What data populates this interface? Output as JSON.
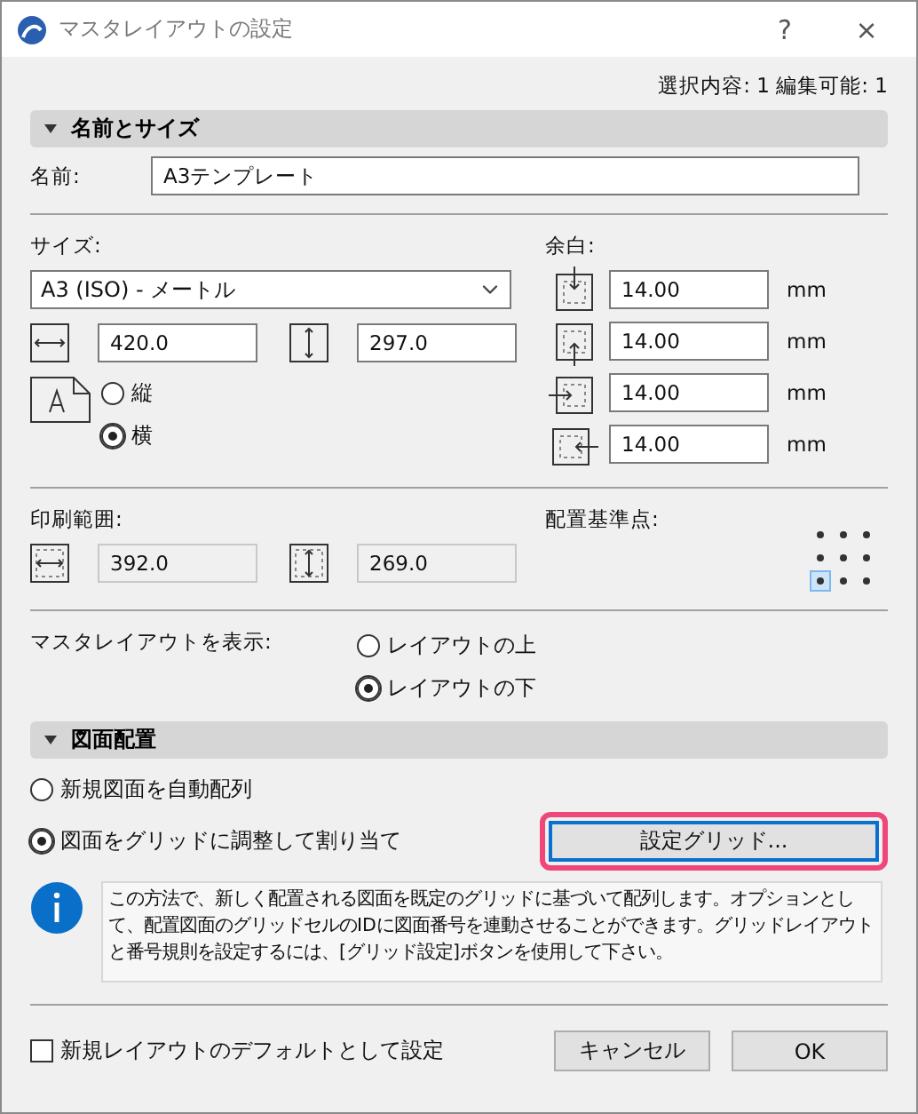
{
  "window": {
    "title": "マスタレイアウトの設定",
    "help": "?",
    "close": "×"
  },
  "summary": "選択内容: 1 編集可能: 1",
  "name_section": {
    "title": "名前とサイズ",
    "expanded": true,
    "name_label": "名前:",
    "name_value": "A3テンプレート"
  },
  "size": {
    "label": "サイズ:",
    "value": "A3 (ISO) - メートル",
    "horizontal": "420.0",
    "vertical": "297.0",
    "orientation": [
      {
        "label": "縦",
        "selected": false
      },
      {
        "label": "横",
        "selected": true
      }
    ]
  },
  "margins": {
    "label": "余白:",
    "items": [
      {
        "kind": "top",
        "value": "14.00",
        "unit": "mm"
      },
      {
        "kind": "bottom",
        "value": "14.00",
        "unit": "mm"
      },
      {
        "kind": "left",
        "value": "14.00",
        "unit": "mm"
      },
      {
        "kind": "right",
        "value": "14.00",
        "unit": "mm"
      }
    ]
  },
  "print_area": {
    "label": "印刷範囲:",
    "horizontal": "392.0",
    "vertical": "269.0"
  },
  "anchor": {
    "label": "配置基準点:",
    "points": [
      {
        "selected": false
      },
      {
        "selected": false
      },
      {
        "selected": false
      },
      {
        "selected": false
      },
      {
        "selected": false
      },
      {
        "selected": false
      },
      {
        "selected": true
      },
      {
        "selected": false
      },
      {
        "selected": false
      }
    ]
  },
  "display": {
    "label": "マスタレイアウトを表示:",
    "options": [
      {
        "label": "レイアウトの上",
        "selected": false
      },
      {
        "label": "レイアウトの下",
        "selected": true
      }
    ]
  },
  "placement_section": {
    "title": "図面配置",
    "expanded": true,
    "options": [
      {
        "label": "新規図面を自動配列",
        "selected": false
      },
      {
        "label": "図面をグリッドに調整して割り当て",
        "selected": true
      }
    ],
    "grid_button": {
      "label": "設定グリッド...",
      "highlighted": true
    },
    "info": "この方法で、新しく配置される図面を既定のグリッドに基づいて配列します。オプションとして、配置図面のグリッドセルのIDに図面番号を連動させることができます。グリッドレイアウトと番号規則を設定するには、[グリッド設定]ボタンを使用して下さい。"
  },
  "default_checkbox": {
    "label": "新規レイアウトのデフォルトとして設定",
    "checked": false
  },
  "buttons": [
    "キャンセル",
    "OK"
  ]
}
